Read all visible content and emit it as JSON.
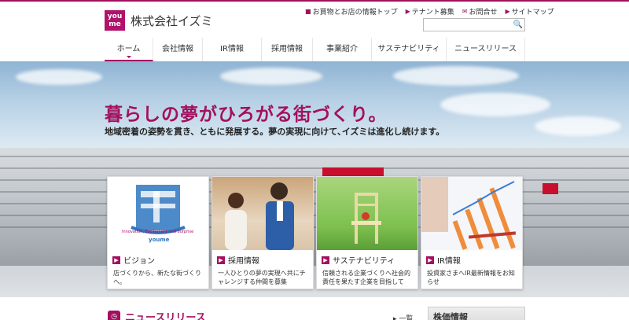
{
  "brand": {
    "logo_text": "you me",
    "company": "株式会社イズミ",
    "accent": "#a3105f"
  },
  "utility_links": [
    {
      "icon": "shop-icon",
      "label": "お買物とお店の情報トップ"
    },
    {
      "icon": "arrow-right-icon",
      "label": "テナント募集"
    },
    {
      "icon": "mail-icon",
      "label": "お問合せ"
    },
    {
      "icon": "sitemap-icon",
      "label": "サイトマップ"
    }
  ],
  "search": {
    "placeholder": "",
    "button_icon": "search-icon"
  },
  "nav": [
    {
      "label": "ホーム",
      "active": true
    },
    {
      "label": "会社情報"
    },
    {
      "label": "IR情報"
    },
    {
      "label": "採用情報"
    },
    {
      "label": "事業紹介"
    },
    {
      "label": "サステナビリティ"
    },
    {
      "label": "ニュースリリース"
    }
  ],
  "hero": {
    "title": "暮らしの夢がひろがる街づくり。",
    "subtitle": "地域密着の姿勢を貫き、ともに発展する。夢の実現に向けて､イズミは進化し続けます。"
  },
  "cards": [
    {
      "label": "ビジョン",
      "desc": "店づくりから、新たな街づくりへ。",
      "image_caption": "Innovation, Excitement and Surprise",
      "image_brand": "youme"
    },
    {
      "label": "採用情報",
      "desc": "一人ひとりの夢の実現へ共にチャレンジする仲間を募集"
    },
    {
      "label": "サステナビリティ",
      "desc": "信頼される企業づくりへ社会的責任を果たす企業を目指して"
    },
    {
      "label": "IR情報",
      "desc": "投資家さまへIR最新情報をお知らせ"
    }
  ],
  "news": {
    "title": "ニュースリリース",
    "list_link": "一覧"
  },
  "stock": {
    "title": "株価情報"
  }
}
